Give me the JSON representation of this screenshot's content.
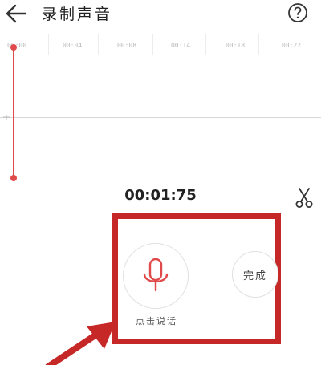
{
  "header": {
    "title": "录制声音",
    "back_icon": "arrow-left-icon",
    "help_icon": "question-circle-icon"
  },
  "ruler": {
    "ticks": [
      "00:00",
      "00:04",
      "00:08",
      "00:14",
      "00:18",
      "00:22"
    ]
  },
  "playback": {
    "time": "00:01:75",
    "cut_icon": "scissors-icon"
  },
  "controls": {
    "mic_icon": "microphone-icon",
    "mic_label": "点击说话",
    "done_label": "完成"
  },
  "colors": {
    "accent": "#e04a4a",
    "annotation": "#c62828"
  }
}
